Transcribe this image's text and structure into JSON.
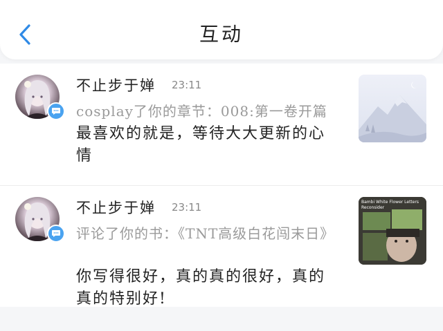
{
  "header": {
    "title": "互动",
    "back_icon": "chevron-left-icon",
    "accent": "#2f8ae6"
  },
  "items": [
    {
      "user": "不止步于婵",
      "time": "23:11",
      "action": "cosplay了你的章节：008:第一卷开篇",
      "comment": "最喜欢的就是，等待大大更新的心情",
      "badge_icon": "comment-bubble-icon",
      "thumb": "mountain-moon-placeholder-image"
    },
    {
      "user": "不止步于婵",
      "time": "23:11",
      "action": "评论了你的书：《TNT高级白花闯末日》",
      "comment": "你写得很好，真的真的很好，真的真的特别好!",
      "badge_icon": "comment-bubble-icon",
      "thumb": "book-cover-image",
      "thumb_caption": "Bambi White Flower Letters Reconsider"
    }
  ]
}
